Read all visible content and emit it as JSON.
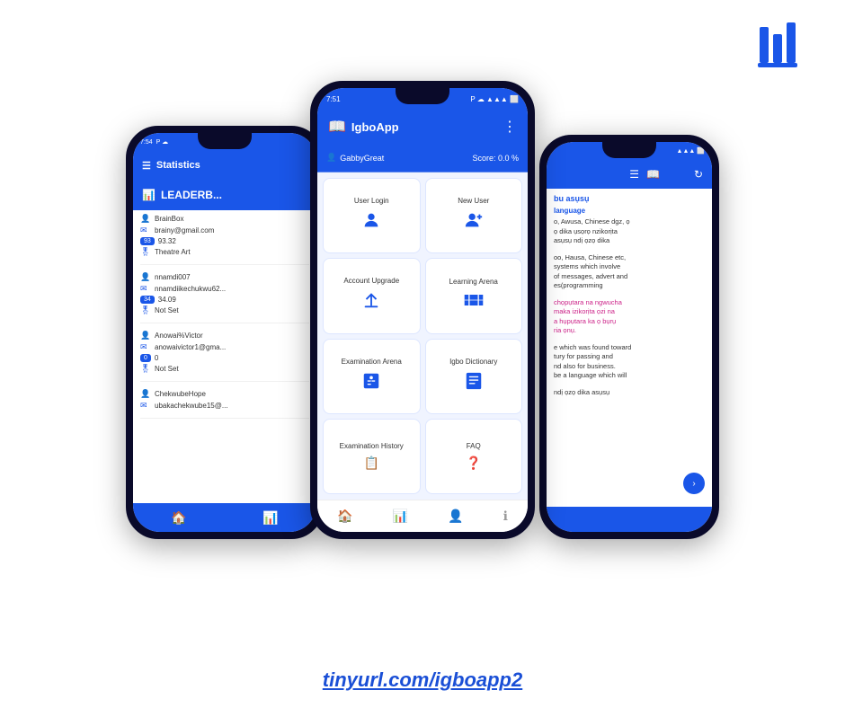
{
  "logo": {
    "alt": "Library Logo"
  },
  "url": {
    "text": "tinyurl.com/igboapp2",
    "href": "https://tinyurl.com/igboapp2"
  },
  "center_phone": {
    "status": {
      "time": "7:51",
      "signal": "▲▲▲",
      "battery": "⬜"
    },
    "header": {
      "icon": "📖",
      "title": "IgboApp",
      "menu": "⋮"
    },
    "user_bar": {
      "user": "GabbyGreat",
      "score_label": "Score: 0.0 %"
    },
    "grid": [
      {
        "label": "User Login",
        "icon": "👤"
      },
      {
        "label": "New User",
        "icon": "👤+"
      },
      {
        "label": "Account Upgrade",
        "icon": "⬆"
      },
      {
        "label": "Learning Arena",
        "icon": "📖"
      },
      {
        "label": "Examination Arena",
        "icon": "💬"
      },
      {
        "label": "Igbo Dictionary",
        "icon": "📋"
      },
      {
        "label": "Examination History",
        "icon": ""
      },
      {
        "label": "FAQ",
        "icon": ""
      }
    ],
    "bottom_nav": [
      {
        "icon": "🏠",
        "active": true
      },
      {
        "icon": "📊",
        "active": false
      },
      {
        "icon": "👤",
        "active": false
      },
      {
        "icon": "ℹ",
        "active": false
      }
    ]
  },
  "left_phone": {
    "status": {
      "time": "7:54",
      "icons": "P ☁"
    },
    "header": {
      "icon": "☰",
      "title": "Statistics"
    },
    "leaderboard": {
      "title": "LEADERB..."
    },
    "users": [
      {
        "name": "BrainBox",
        "email": "brainy@gmail.com",
        "score": "93.32",
        "badge": "Theatre Art"
      },
      {
        "name": "nnamdi007",
        "email": "nnamdiikechukwu62...",
        "score": "34.09",
        "badge": "Not Set"
      },
      {
        "name": "Anowai%Victor",
        "email": "anowaivictor1@gma...",
        "score": "0",
        "badge": "Not Set"
      },
      {
        "name": "ChekwubeHope",
        "email": "ubakachekwube15@..."
      }
    ],
    "bottom_nav": [
      {
        "icon": "🏠"
      },
      {
        "icon": "📊"
      }
    ]
  },
  "right_phone": {
    "status": {
      "signal": "▲▲▲",
      "battery": "⬜"
    },
    "toolbar_icons": [
      "☰",
      "📖"
    ],
    "sections": [
      {
        "heading": "bu asụsụ",
        "subheading": "language",
        "text": "o, Awusa, Chinese dgz, ọ ọ dika ụsọrọ nzikorịta asụsụ ndị ọzọ dika"
      },
      {
        "text": "oo, Hausa, Chinese etc, systems which involve of messages, advert and es(programming"
      },
      {
        "text": "chọpụtara na ngwucha maka izikorịta ọzi na a hụpụtara ka ọ bụrụ ria ọnụ.",
        "pink": true
      },
      {
        "text": "e which was found toward tury for passing and nd also for business. be a language which will"
      },
      {
        "text": "ndị ọzọ dika asụsụ"
      }
    ]
  }
}
